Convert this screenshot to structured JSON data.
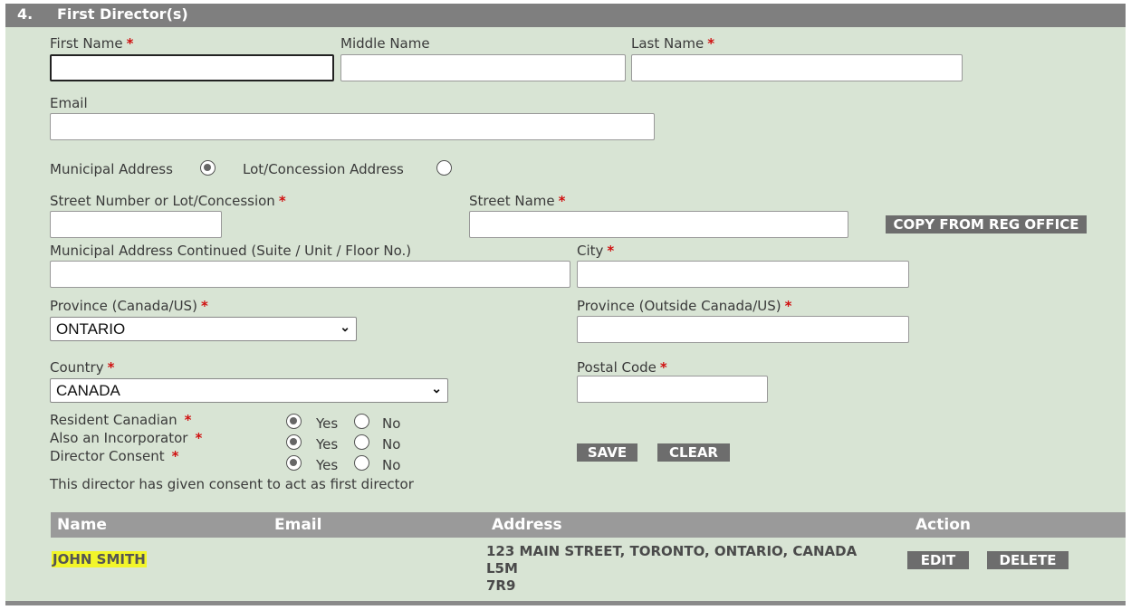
{
  "section": {
    "number": "4.",
    "title": "First Director(s)"
  },
  "required_mark": "*",
  "fields": {
    "first_name": {
      "label": "First Name",
      "value": ""
    },
    "middle_name": {
      "label": "Middle Name",
      "value": ""
    },
    "last_name": {
      "label": "Last Name",
      "value": ""
    },
    "email": {
      "label": "Email",
      "value": ""
    },
    "street_number": {
      "label": "Street Number or Lot/Concession",
      "value": ""
    },
    "street_name": {
      "label": "Street Name",
      "value": ""
    },
    "address_continued": {
      "label": "Municipal Address Continued (Suite / Unit / Floor No.)",
      "value": ""
    },
    "city": {
      "label": "City",
      "value": ""
    },
    "province_canada_us": {
      "label": "Province (Canada/US)",
      "value": "ONTARIO"
    },
    "province_outside": {
      "label": "Province (Outside Canada/US)",
      "value": ""
    },
    "country": {
      "label": "Country",
      "value": "CANADA"
    },
    "postal_code": {
      "label": "Postal Code",
      "value": ""
    }
  },
  "address_type": {
    "municipal_label": "Municipal Address",
    "lot_label": "Lot/Concession Address",
    "selected": "municipal"
  },
  "yes_label": "Yes",
  "no_label": "No",
  "questions": [
    {
      "label": "Resident Canadian",
      "selected": "yes"
    },
    {
      "label": "Also an Incorporator",
      "selected": "yes"
    },
    {
      "label": "Director Consent",
      "selected": "yes"
    }
  ],
  "consent_note": "This director has given consent to act as first director",
  "buttons": {
    "copy": "COPY FROM REG OFFICE",
    "save": "SAVE",
    "clear": "CLEAR",
    "edit": "EDIT",
    "delete": "DELETE"
  },
  "table": {
    "headers": {
      "name": "Name",
      "email": "Email",
      "address": "Address",
      "action": "Action"
    },
    "rows": [
      {
        "name": "JOHN SMITH",
        "email": "",
        "address_line1": "123 MAIN STREET, TORONTO, ONTARIO, CANADA L5M",
        "address_line2": "7R9"
      }
    ]
  },
  "colors": {
    "panel_bg": "#d8e4d4",
    "header_bg": "#7f7f7f",
    "button_bg": "#6d6d6d",
    "required": "#d01010",
    "highlight": "#f2f52a"
  }
}
